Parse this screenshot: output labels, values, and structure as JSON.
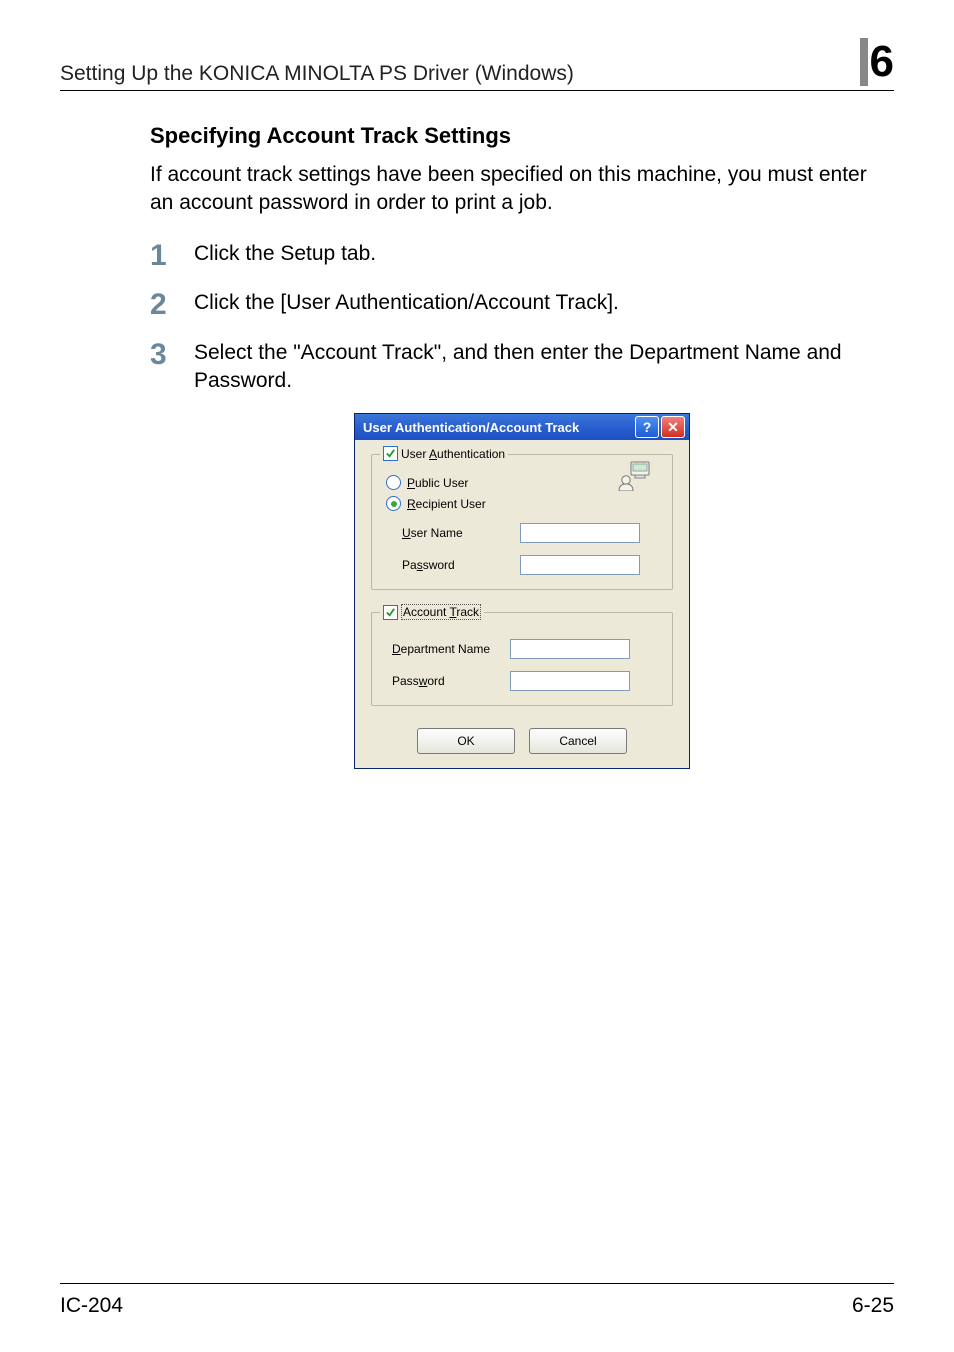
{
  "header": {
    "running_head": "Setting Up the KONICA MINOLTA PS Driver (Windows)",
    "chapter_number": "6"
  },
  "section": {
    "title": "Specifying Account Track Settings",
    "intro": "If account track settings have been specified on this machine, you must enter an account password in order to print a job."
  },
  "steps": [
    {
      "n": "1",
      "text": "Click the Setup tab."
    },
    {
      "n": "2",
      "text": "Click the [User Authentication/Account Track]."
    },
    {
      "n": "3",
      "text": "Select the \"Account Track\", and then enter the Department Name and Password."
    }
  ],
  "dialog": {
    "title": "User Authentication/Account Track",
    "help_glyph": "?",
    "close_glyph": "✕",
    "user_auth": {
      "legend_prefix": "User ",
      "legend_ul": "A",
      "legend_suffix": "uthentication",
      "checked": true,
      "public_user_ul": "P",
      "public_user_rest": "ublic User",
      "recipient_user_ul": "R",
      "recipient_user_rest": "ecipient User",
      "user_name_ul": "U",
      "user_name_rest": "ser Name",
      "password_pre": "Pa",
      "password_ul": "s",
      "password_post": "sword"
    },
    "account_track": {
      "legend_prefix": "Account ",
      "legend_ul": "T",
      "legend_suffix": "rack",
      "checked": true,
      "dept_ul": "D",
      "dept_rest": "epartment Name",
      "password_pre": "Pass",
      "password_ul": "w",
      "password_post": "ord"
    },
    "ok": "OK",
    "cancel": "Cancel"
  },
  "footer": {
    "left": "IC-204",
    "right": "6-25"
  }
}
